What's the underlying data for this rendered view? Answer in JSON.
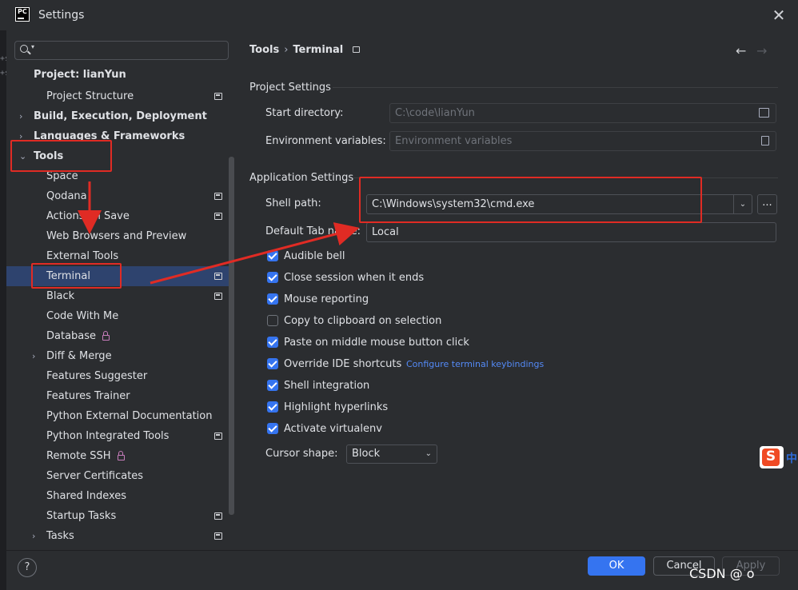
{
  "window": {
    "title": "Settings",
    "logo_text": "PC"
  },
  "edge_fragments": [
    "e(",
    "+s",
    "+s"
  ],
  "sidebar": {
    "search_placeholder": "",
    "items": [
      {
        "label": "Project: lianYun",
        "bold": true
      },
      {
        "label": "Project Structure"
      },
      {
        "label": "Build, Execution, Deployment",
        "bold": true
      },
      {
        "label": "Languages & Frameworks",
        "bold": true
      },
      {
        "label": "Tools",
        "bold": true
      },
      {
        "label": "Space"
      },
      {
        "label": "Qodana"
      },
      {
        "label": "Actions on Save"
      },
      {
        "label": "Web Browsers and Preview"
      },
      {
        "label": "External Tools"
      },
      {
        "label": "Terminal"
      },
      {
        "label": "Black"
      },
      {
        "label": "Code With Me"
      },
      {
        "label": "Database"
      },
      {
        "label": "Diff & Merge"
      },
      {
        "label": "Features Suggester"
      },
      {
        "label": "Features Trainer"
      },
      {
        "label": "Python External Documentation"
      },
      {
        "label": "Python Integrated Tools"
      },
      {
        "label": "Remote SSH"
      },
      {
        "label": "Server Certificates"
      },
      {
        "label": "Shared Indexes"
      },
      {
        "label": "Startup Tasks"
      },
      {
        "label": "Tasks"
      }
    ]
  },
  "main": {
    "breadcrumb": {
      "parent": "Tools",
      "separator": "›",
      "current": "Terminal"
    },
    "nav": {
      "back": "←",
      "forward": "→"
    },
    "project_settings": {
      "title": "Project Settings",
      "start_directory_label": "Start directory:",
      "start_directory_value": "C:\\code\\lianYun",
      "env_vars_label": "Environment variables:",
      "env_vars_placeholder": "Environment variables"
    },
    "application_settings": {
      "title": "Application Settings",
      "shell_path_label": "Shell path:",
      "shell_path_value": "C:\\Windows\\system32\\cmd.exe",
      "ellipsis": "...",
      "tab_name_label": "Default Tab name:",
      "tab_name_value": "Local",
      "checkboxes": [
        {
          "label": "Audible bell",
          "checked": true
        },
        {
          "label": "Close session when it ends",
          "checked": true
        },
        {
          "label": "Mouse reporting",
          "checked": true
        },
        {
          "label": "Copy to clipboard on selection",
          "checked": false
        },
        {
          "label": "Paste on middle mouse button click",
          "checked": true
        },
        {
          "label": "Override IDE shortcuts",
          "checked": true
        },
        {
          "label": "Shell integration",
          "checked": true
        },
        {
          "label": "Highlight hyperlinks",
          "checked": true
        },
        {
          "label": "Activate virtualenv",
          "checked": true
        }
      ],
      "keybindings_link": "Configure terminal keybindings",
      "cursor_shape_label": "Cursor shape:",
      "cursor_shape_value": "Block"
    }
  },
  "footer": {
    "help": "?",
    "ok": "OK",
    "cancel": "Cancel",
    "apply": "Apply"
  },
  "overlay": {
    "watermark": "CSDN @    o",
    "ime_icon": "S",
    "ime_lang": "中"
  },
  "colors": {
    "accent": "#3574f0",
    "selection": "#2e436e",
    "annotation": "#e02b24",
    "link": "#548af7"
  }
}
